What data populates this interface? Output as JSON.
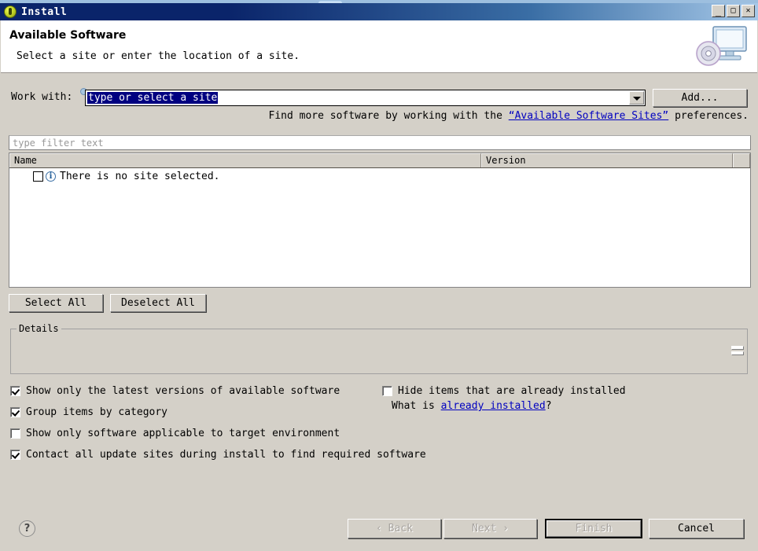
{
  "window": {
    "title": "Install",
    "icon": "eclipse-install-icon",
    "controls": {
      "minimize": "_",
      "maximize": "□",
      "close": "✕"
    }
  },
  "banner": {
    "title": "Available Software",
    "subtitle": "Select a site or enter the location of a site.",
    "icon": "computer-cd-icon"
  },
  "work_with": {
    "label": "Work with:",
    "value": "type or select a site",
    "placeholder": "type or select a site",
    "add_button": "Add...",
    "info_icon": "info-icon"
  },
  "hint": {
    "before": "Find more software by working with the ",
    "link": "“Available Software Sites”",
    "after": " preferences."
  },
  "filter": {
    "placeholder": "type filter text",
    "value": ""
  },
  "table": {
    "columns": [
      "Name",
      "Version",
      ""
    ],
    "rows": [
      {
        "checked": false,
        "icon": "info-icon",
        "name": "There is no site selected.",
        "version": ""
      }
    ]
  },
  "selection_buttons": {
    "select_all": "Select All",
    "deselect_all": "Deselect All"
  },
  "details": {
    "legend": "Details",
    "content": "",
    "grip": "resize-grip-icon"
  },
  "options_left": [
    {
      "label": "Show only the latest versions of available software",
      "checked": true
    },
    {
      "label": "Group items by category",
      "checked": true
    },
    {
      "label": "Show only software applicable to target environment",
      "checked": false
    },
    {
      "label": "Contact all update sites during install to find required software",
      "checked": true
    }
  ],
  "options_right": [
    {
      "label": "Hide items that are already installed",
      "checked": false
    }
  ],
  "what_is": {
    "before": "What is ",
    "link": "already installed",
    "after": "?"
  },
  "footer": {
    "help": "?",
    "back": "‹ Back",
    "next": "Next ›",
    "finish": "Finish",
    "cancel": "Cancel"
  },
  "colors": {
    "titlebar_start": "#0a246a",
    "titlebar_end": "#a6c8e8",
    "dialog_bg": "#d4d0c8",
    "link": "#0000c0",
    "selection": "#000080"
  }
}
